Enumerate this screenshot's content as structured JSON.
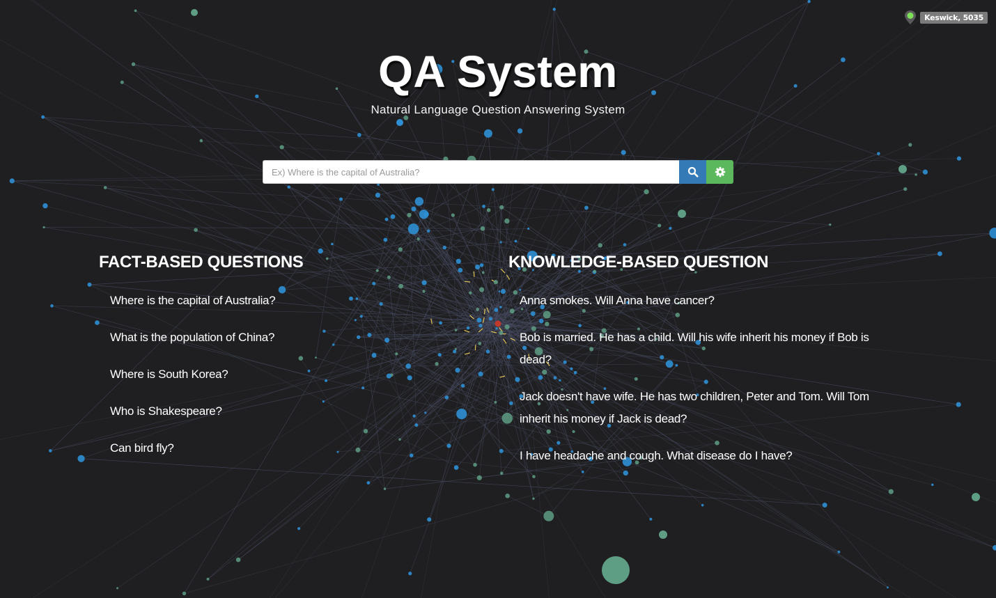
{
  "location": {
    "label": "Keswick, 5035"
  },
  "header": {
    "title": "QA System",
    "subtitle": "Natural Language Question Answering System"
  },
  "search": {
    "placeholder": "Ex) Where is the capital of Australia?",
    "value": "",
    "search_icon": "search-icon",
    "settings_icon": "gear-icon"
  },
  "sections": {
    "fact": {
      "title": "FACT-BASED QUESTIONS",
      "questions": [
        "Where is the capital of Australia?",
        "What is the population of China?",
        "Where is South Korea?",
        "Who is Shakespeare?",
        "Can bird fly?"
      ]
    },
    "knowledge": {
      "title": "KNOWLEDGE-BASED QUESTION",
      "questions": [
        "Anna smokes. Will Anna have cancer?",
        "Bob is married. He has a child. Will his wife inherit his money if Bob is dead?",
        "Jack doesn't have wife. He has two children, Peter and Tom. Will Tom inherit his money if Jack is dead?",
        "I have headache and cough. What disease do I have?"
      ]
    }
  },
  "colors": {
    "background": "#1f1f21",
    "search_button": "#337ab7",
    "settings_button": "#5cb85c",
    "node_blue": "#2f8fd4",
    "node_green": "#5e9e84",
    "link": "#4a4f66",
    "accent_yellow": "#e2c35a",
    "center_red": "#c0392b",
    "pin_green": "#7fe05a"
  }
}
